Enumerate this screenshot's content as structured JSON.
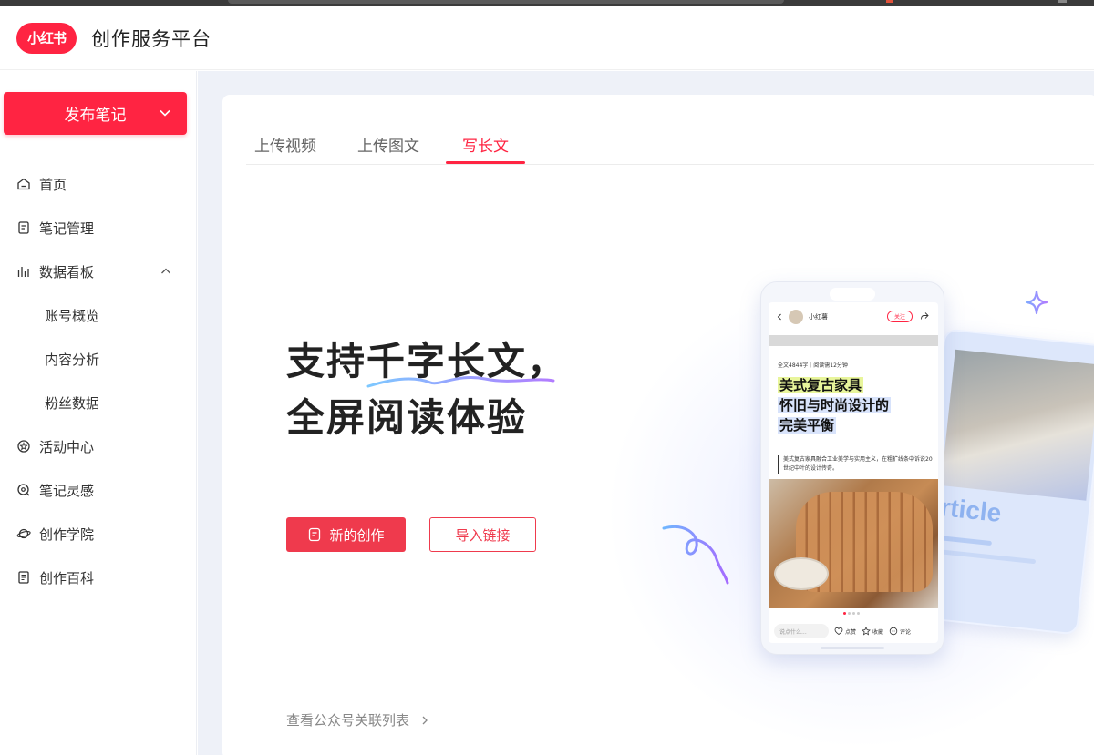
{
  "header": {
    "logo_text": "小红书",
    "title": "创作服务平台"
  },
  "sidebar": {
    "publish_label": "发布笔记",
    "items": [
      {
        "label": "首页",
        "icon": "home-icon"
      },
      {
        "label": "笔记管理",
        "icon": "note-icon"
      },
      {
        "label": "数据看板",
        "icon": "bar-chart-icon"
      },
      {
        "label": "活动中心",
        "icon": "activity-icon"
      },
      {
        "label": "笔记灵感",
        "icon": "inspiration-icon"
      },
      {
        "label": "创作学院",
        "icon": "planet-icon"
      },
      {
        "label": "创作百科",
        "icon": "book-icon"
      }
    ],
    "sub_items": [
      "账号概览",
      "内容分析",
      "粉丝数据"
    ]
  },
  "tabs": [
    {
      "label": "上传视频",
      "active": false
    },
    {
      "label": "上传图文",
      "active": false
    },
    {
      "label": "写长文",
      "active": true
    }
  ],
  "hero": {
    "line1": "支持千字长文，",
    "line2": "全屏阅读体验"
  },
  "actions": {
    "new_label": "新的创作",
    "import_label": "导入链接"
  },
  "bottom_link": "查看公众号关联列表",
  "phone": {
    "account_name": "小红薯",
    "follow_label": "关注",
    "meta": "全文4844字｜阅读需12分钟",
    "title_lines": [
      "美式复古家具",
      "怀旧与时尚设计的",
      "完美平衡"
    ],
    "desc": "美式复古家具融合工业美学与实用主义，在粗犷线条中诉说20世纪中叶的设计传奇。",
    "comment_placeholder": "说点什么...",
    "like_label": "点赞",
    "collect_label": "收藏",
    "comment_label": "评论"
  },
  "back_card_word": "rticle",
  "colors": {
    "brand": "#ff2442",
    "button": "#ef3a4d",
    "main_bg": "#eef1f8"
  }
}
